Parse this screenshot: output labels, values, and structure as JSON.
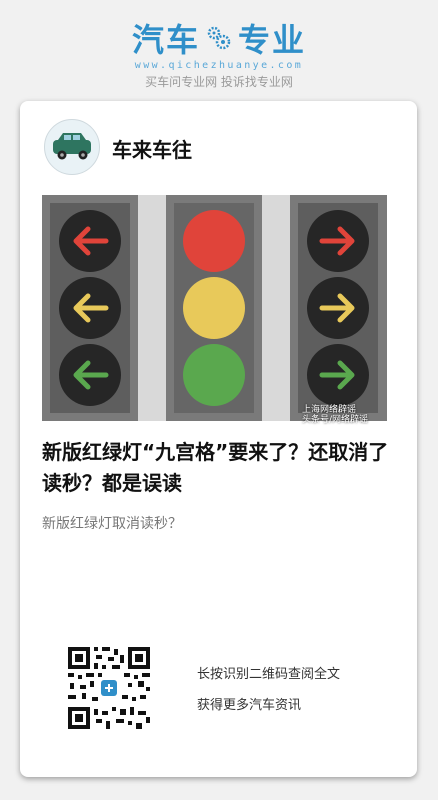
{
  "brand": {
    "name_left": "汽车",
    "name_right": "专业",
    "url": "www.qichezhuanye.com",
    "slogan": "买车问专业网 投诉找专业网"
  },
  "post": {
    "author": "车来车往",
    "image_watermark_line1": "上海网络辟谣",
    "image_watermark_line2": "头条号/网络辟谣",
    "title": "新版红绿灯“九宫格”要来了？还取消了读秒？都是误读",
    "summary": "新版红绿灯取消读秒？"
  },
  "qr": {
    "line1": "长按识别二维码查阅全文",
    "line2": "获得更多汽车资讯"
  },
  "colors": {
    "brand_blue": "#2f8fc9",
    "light_red": "#e0443a",
    "light_yellow": "#e8c95a",
    "light_green": "#5aa84e"
  }
}
